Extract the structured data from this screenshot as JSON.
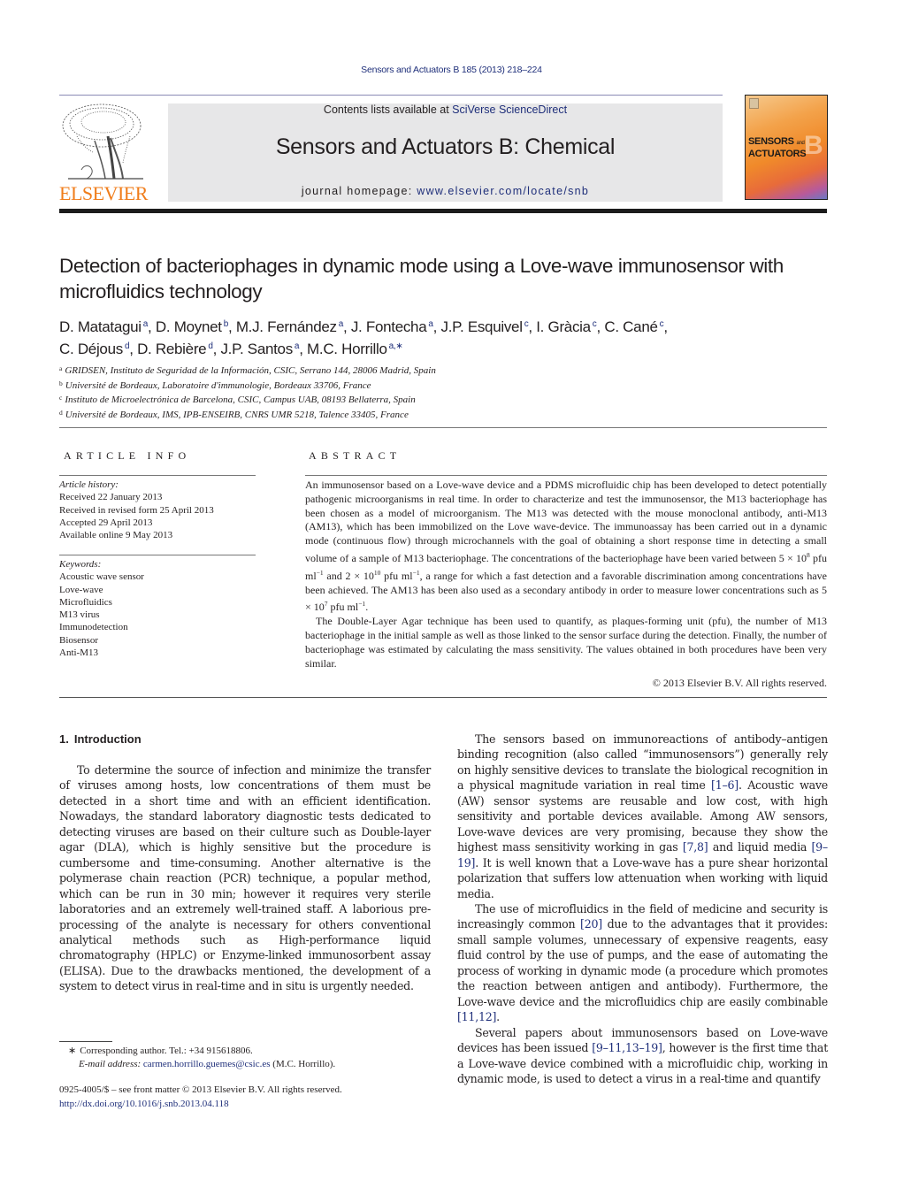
{
  "running_head": "Sensors and Actuators B 185 (2013) 218–224",
  "masthead": {
    "publisher_logo_text": "ELSEVIER",
    "contents_prefix": "Contents lists available at ",
    "contents_link": "SciVerse ScienceDirect",
    "journal_title": "Sensors and Actuators B: Chemical",
    "homepage_prefix": "journal homepage: ",
    "homepage_link": "www.elsevier.com/locate/snb",
    "cover": {
      "line1": "SENSORS",
      "and": "and",
      "line2": "ACTUATORS",
      "letter": "B"
    }
  },
  "article": {
    "title": "Detection of bacteriophages in dynamic mode using a Love-wave immunosensor with microfluidics technology",
    "authors": [
      {
        "name": "D. Matatagui",
        "aff": "a",
        "sep": ", "
      },
      {
        "name": "D. Moynet",
        "aff": "b",
        "sep": ", "
      },
      {
        "name": "M.J. Fernández",
        "aff": "a",
        "sep": ", "
      },
      {
        "name": "J. Fontecha",
        "aff": "a",
        "sep": ", "
      },
      {
        "name": "J.P. Esquivel",
        "aff": "c",
        "sep": ", "
      },
      {
        "name": "I. Gràcia",
        "aff": "c",
        "sep": ", "
      },
      {
        "name": "C. Cané",
        "aff": "c",
        "sep": ","
      },
      {
        "name": "C. Déjous",
        "aff": "d",
        "sep": ", "
      },
      {
        "name": "D. Rebière",
        "aff": "d",
        "sep": ", "
      },
      {
        "name": "J.P. Santos",
        "aff": "a",
        "sep": ", "
      },
      {
        "name": "M.C. Horrillo",
        "aff": "a,∗",
        "sep": ""
      }
    ],
    "affiliations": [
      {
        "key": "a",
        "text": "GRIDSEN, Instituto de Seguridad de la Información, CSIC, Serrano 144, 28006 Madrid, Spain"
      },
      {
        "key": "b",
        "text": "Université de Bordeaux, Laboratoire d'immunologie, Bordeaux 33706, France"
      },
      {
        "key": "c",
        "text": "Instituto de Microelectrónica de Barcelona, CSIC, Campus UAB, 08193 Bellaterra, Spain"
      },
      {
        "key": "d",
        "text": "Université de Bordeaux, IMS, IPB-ENSEIRB, CNRS UMR 5218, Talence 33405, France"
      }
    ]
  },
  "article_info": {
    "label": "ARTICLE INFO",
    "history_label": "Article history:",
    "history": [
      "Received 22 January 2013",
      "Received in revised form 25 April 2013",
      "Accepted 29 April 2013",
      "Available online 9 May 2013"
    ],
    "keywords_label": "Keywords:",
    "keywords": [
      "Acoustic wave sensor",
      "Love-wave",
      "Microfluidics",
      "M13 virus",
      "Immunodetection",
      "Biosensor",
      "Anti-M13"
    ]
  },
  "abstract": {
    "label": "ABSTRACT",
    "p1_a": "An immunosensor based on a Love-wave device and a PDMS microfluidic chip has been developed to detect potentially pathogenic microorganisms in real time. In order to characterize and test the immunosensor, the M13 bacteriophage has been chosen as a model of microorganism. The M13 was detected with the mouse monoclonal antibody, anti-M13 (AM13), which has been immobilized on the Love wave-device. The immunoassay has been carried out in a dynamic mode (continuous flow) through microchannels with the goal of obtaining a short response time in detecting a small volume of a sample of M13 bacteriophage. The concentrations of the bacteriophage have been varied between 5 × 10",
    "p1_exp1": "8",
    "p1_b": " pfu ml",
    "p1_exp2": "−1",
    "p1_c": " and 2 × 10",
    "p1_exp3": "10",
    "p1_d": " pfu ml",
    "p1_exp4": "−1",
    "p1_e": ", a range for which a fast detection and a favorable discrimination among concentrations have been achieved. The AM13 has been also used as a secondary antibody in order to measure lower concentrations such as 5 × 10",
    "p1_exp5": "7",
    "p1_f": " pfu ml",
    "p1_exp6": "−1",
    "p1_g": ".",
    "p2": "The Double-Layer Agar technique has been used to quantify, as plaques-forming unit (pfu), the number of M13 bacteriophage in the initial sample as well as those linked to the sensor surface during the detection. Finally, the number of bacteriophage was estimated by calculating the mass sensitivity. The values obtained in both procedures have been very similar.",
    "copyright": "© 2013 Elsevier B.V. All rights reserved."
  },
  "introduction": {
    "number": "1.",
    "heading": "Introduction",
    "left_p1": "To determine the source of infection and minimize the transfer of viruses among hosts, low concentrations of them must be detected in a short time and with an efficient identification. Nowadays, the standard laboratory diagnostic tests dedicated to detecting viruses are based on their culture such as Double-layer agar (DLA), which is highly sensitive but the procedure is cumbersome and time-consuming. Another alternative is the polymerase chain reaction (PCR) technique, a popular method, which can be run in 30 min; however it requires very sterile laboratories and an extremely well-trained staff. A laborious pre-processing of the analyte is necessary for others conventional analytical methods such as High-performance liquid chromatography (HPLC) or Enzyme-linked immunosorbent assay (ELISA). Due to the drawbacks mentioned, the development of a system to detect virus in real-time and in situ is urgently needed.",
    "right_p1": {
      "t1": "The sensors based on immunoreactions of antibody–antigen binding recognition (also called “immunosensors”) generally rely on highly sensitive devices to translate the biological recognition in a physical magnitude variation in real time ",
      "r1": "[1–6]",
      "t2": ". Acoustic wave (AW) sensor systems are reusable and low cost, with high sensitivity and portable devices available. Among AW sensors, Love-wave devices are very promising, because they show the highest mass sensitivity working in gas ",
      "r2": "[7,8]",
      "t3": " and liquid media ",
      "r3": "[9–19]",
      "t4": ". It is well known that a Love-wave has a pure shear horizontal polarization that suffers low attenuation when working with liquid media."
    },
    "right_p2": {
      "t1": "The use of microfluidics in the field of medicine and security is increasingly common ",
      "r1": "[20]",
      "t2": " due to the advantages that it provides: small sample volumes, unnecessary of expensive reagents, easy fluid control by the use of pumps, and the ease of automating the process of working in dynamic mode (a procedure which promotes the reaction between antigen and antibody). Furthermore, the Love-wave device and the microfluidics chip are easily combinable ",
      "r2": "[11,12]",
      "t3": "."
    },
    "right_p3": {
      "t1": "Several papers about immunosensors based on Love-wave devices has been issued ",
      "r1": "[9–11,13–19]",
      "t2": ", however is the first time that a Love-wave device combined with a microfluidic chip, working in dynamic mode, is used to detect a virus in a real-time and quantify"
    }
  },
  "footnote": {
    "marker": "∗",
    "corresponding": "Corresponding author. Tel.: +34 915618806.",
    "email_label": "E-mail address:",
    "email": "carmen.horrillo.guemes@csic.es",
    "email_suffix": " (M.C. Horrillo)."
  },
  "front_matter": {
    "issn_line": "0925-4005/$ – see front matter © 2013 Elsevier B.V. All rights reserved.",
    "doi": "http://dx.doi.org/10.1016/j.snb.2013.04.118"
  },
  "colors": {
    "link": "#1f2f7a",
    "elsevier_orange": "#f07d1b",
    "band_gray": "#e7e7e8"
  }
}
